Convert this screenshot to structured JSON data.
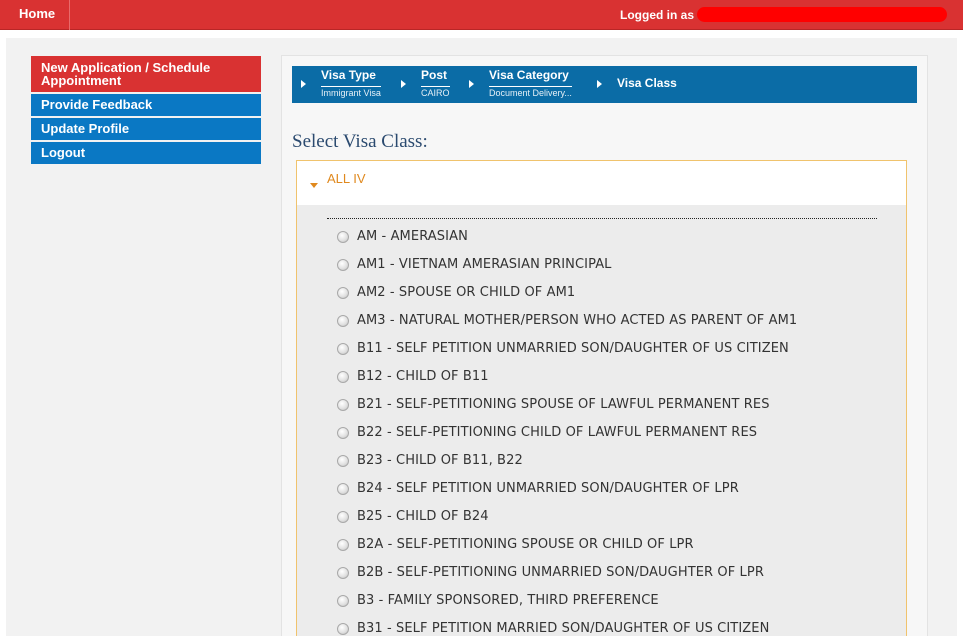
{
  "topbar": {
    "home_label": "Home",
    "logged_in_label": "Logged in as"
  },
  "sidebar": {
    "items": [
      {
        "label": "New Application / Schedule Appointment"
      },
      {
        "label": "Provide Feedback"
      },
      {
        "label": "Update Profile"
      },
      {
        "label": "Logout"
      }
    ]
  },
  "breadcrumb": {
    "steps": [
      {
        "label": "Visa Type",
        "sub": "Immigrant Visa"
      },
      {
        "label": "Post",
        "sub": "CAIRO"
      },
      {
        "label": "Visa Category",
        "sub": "Document Delivery..."
      },
      {
        "label": "Visa Class",
        "sub": ""
      }
    ]
  },
  "main": {
    "title": "Select Visa Class:",
    "accordion_title": "ALL IV",
    "options": [
      "AM - AMERASIAN",
      "AM1 - VIETNAM AMERASIAN PRINCIPAL",
      "AM2 - SPOUSE OR CHILD OF AM1",
      "AM3 - NATURAL MOTHER/PERSON WHO ACTED AS PARENT OF AM1",
      "B11 - SELF PETITION UNMARRIED SON/DAUGHTER OF US CITIZEN",
      "B12 - CHILD OF B11",
      "B21 - SELF-PETITIONING SPOUSE OF LAWFUL PERMANENT RES",
      "B22 - SELF-PETITIONING CHILD OF LAWFUL PERMANENT RES",
      "B23 - CHILD OF B11, B22",
      "B24 - SELF PETITION UNMARRIED SON/DAUGHTER OF LPR",
      "B25 - CHILD OF B24",
      "B2A - SELF-PETITIONING SPOUSE OR CHILD OF LPR",
      "B2B - SELF-PETITIONING UNMARRIED SON/DAUGHTER OF LPR",
      "B3 - FAMILY SPONSORED, THIRD PREFERENCE",
      "B31 - SELF PETITION MARRIED SON/DAUGHTER OF US CITIZEN"
    ]
  },
  "colors": {
    "topbar": "#d93232",
    "primary_nav": "#d93232",
    "nav_blue": "#0a78c4",
    "breadcrumb": "#0b6ca6",
    "accordion_accent": "#e0891e"
  }
}
